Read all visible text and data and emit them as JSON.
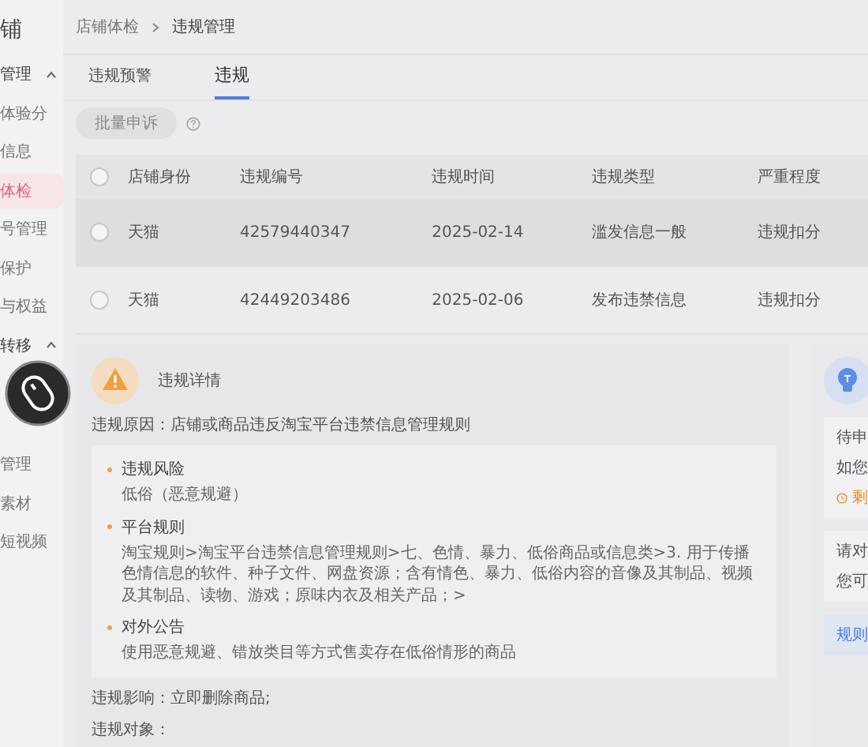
{
  "sidebar": {
    "title": "铺",
    "items": [
      {
        "label": "管理",
        "kind": "group",
        "expanded": true
      },
      {
        "label": "体验分",
        "kind": "item",
        "selected": false
      },
      {
        "label": "信息",
        "kind": "item",
        "selected": false
      },
      {
        "label": "体检",
        "kind": "item",
        "selected": true
      },
      {
        "label": "号管理",
        "kind": "item",
        "selected": false
      },
      {
        "label": "保护",
        "kind": "item",
        "selected": false
      },
      {
        "label": "与权益",
        "kind": "item",
        "selected": false
      },
      {
        "label": "转移",
        "kind": "group",
        "expanded": true
      },
      {
        "label": "管理",
        "kind": "gap-item",
        "selected": false
      },
      {
        "label": "素材",
        "kind": "item",
        "selected": false
      },
      {
        "label": "短视频",
        "kind": "item",
        "selected": false
      }
    ]
  },
  "breadcrumb": [
    "店铺体检",
    "违规管理"
  ],
  "tabs": [
    {
      "label": "违规预警",
      "selected": false
    },
    {
      "label": "违规",
      "selected": true
    }
  ],
  "toolbar": {
    "button": {
      "label": "批量申诉",
      "disabled": true
    }
  },
  "table": {
    "all_checked": false,
    "columns": [
      "店铺身份",
      "违规编号",
      "违规时间",
      "违规类型",
      "严重程度"
    ],
    "rows": [
      {
        "checked": false,
        "highlighted": true,
        "cells": [
          "天猫",
          "42579440347",
          "2025-02-14",
          "滥发信息一般",
          "违规扣分"
        ]
      },
      {
        "checked": false,
        "highlighted": false,
        "cells": [
          "天猫",
          "42449203486",
          "2025-02-06",
          "发布违禁信息",
          "违规扣分"
        ]
      }
    ]
  },
  "detail": {
    "title": "违规详情",
    "reason": "违规原因：店铺或商品违反淘宝平台违禁信息管理规则",
    "sections": [
      {
        "heading": "违规风险",
        "text": "低俗（恶意规避）"
      },
      {
        "heading": "平台规则",
        "text": "淘宝规则>淘宝平台违禁信息管理规则>七、色情、暴力、低俗商品或信息类>3. 用于传播色情信息的软件、种子文件、网盘资源；含有情色、暴力、低俗内容的音像及其制品、视频及其制品、读物、游戏；原味内衣及相关产品；>"
      },
      {
        "heading": "对外公告",
        "text": "使用恶意规避、错放类目等方式售卖存在低俗情形的商品"
      }
    ],
    "impact": "违规影响：立即删除商品;",
    "object": "违规对象："
  },
  "side_panel": {
    "cards": [
      {
        "kind": "appeal",
        "title": "待申",
        "text": "如您",
        "countdown": "剩"
      },
      {
        "kind": "info",
        "title": "请对",
        "text": "您可"
      },
      {
        "kind": "link",
        "title": "规则"
      }
    ]
  }
}
